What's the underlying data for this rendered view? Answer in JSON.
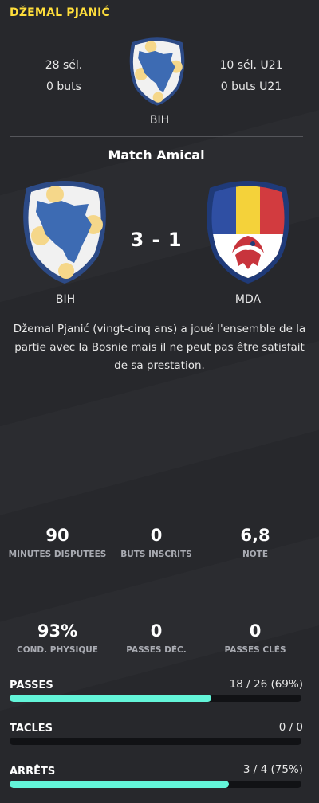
{
  "player_name": "DŽEMAL PJANIĆ",
  "caps": {
    "senior_caps": "28 sél.",
    "senior_goals": "0 buts",
    "u21_caps": "10 sél. U21",
    "u21_goals": "0 buts U21"
  },
  "country_code": "BIH",
  "match": {
    "title": "Match Amical",
    "score": "3 - 1",
    "home": "BIH",
    "away": "MDA"
  },
  "summary": "Džemal Pjanić (vingt-cinq ans) a joué l'ensemble de la partie avec la Bosnie mais il ne peut pas être satisfait de sa prestation.",
  "stats_row1": [
    {
      "value": "90",
      "label": "MINUTES DISPUTÉES"
    },
    {
      "value": "0",
      "label": "BUTS INSCRITS"
    },
    {
      "value": "6,8",
      "label": "NOTE"
    }
  ],
  "stats_row2": [
    {
      "value": "93%",
      "label": "COND. PHYSIQUE"
    },
    {
      "value": "0",
      "label": "PASSES DÉC."
    },
    {
      "value": "0",
      "label": "PASSES CLÉS"
    }
  ],
  "bars": [
    {
      "title": "PASSES",
      "value": "18 / 26 (69%)",
      "fraction": 0.69
    },
    {
      "title": "TACLES",
      "value": "0 / 0",
      "fraction": 0
    },
    {
      "title": "ARRÊTS",
      "value": "3 / 4 (75%)",
      "fraction": 0.75
    }
  ],
  "colors": {
    "accent_name": "#ffde3b",
    "bar_fill": "#63f5d9",
    "bar_track": "#111215",
    "background": "#27282c"
  }
}
